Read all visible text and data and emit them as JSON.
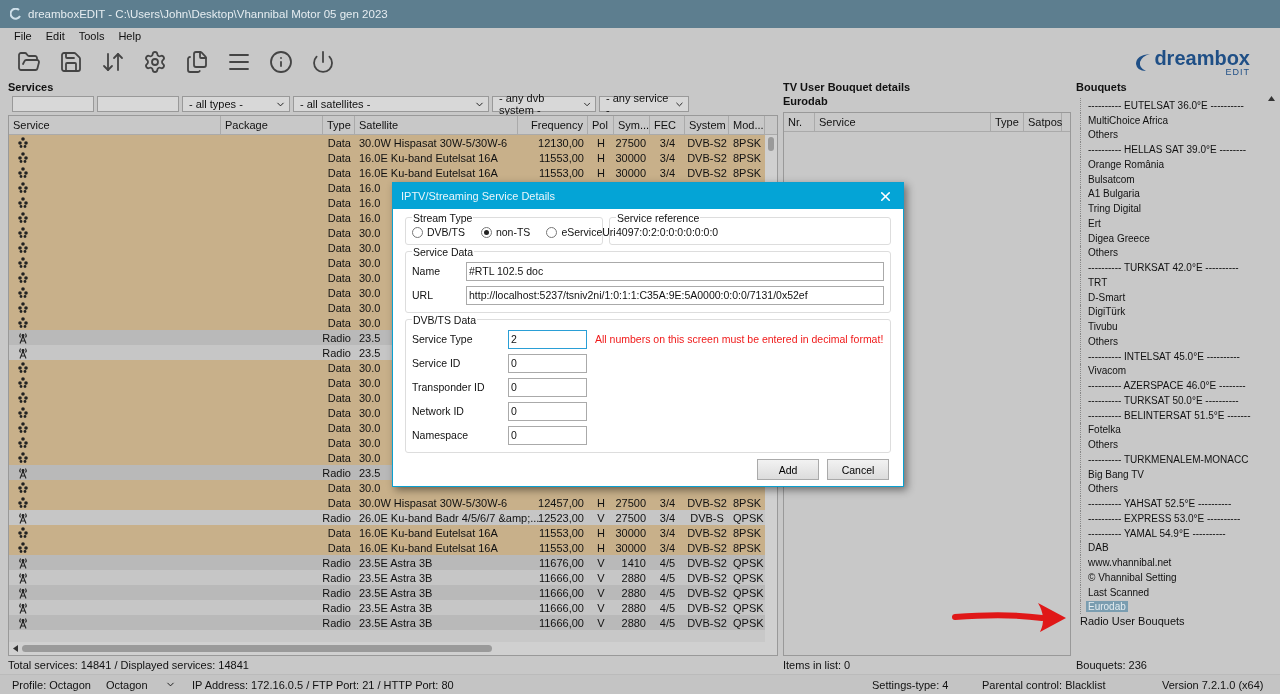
{
  "window": {
    "title": "dreamboxEDIT - C:\\Users\\John\\Desktop\\Vhannibal Motor 05 gen 2023"
  },
  "menu": [
    "File",
    "Edit",
    "Tools",
    "Help"
  ],
  "toolbar": [
    {
      "kind": "open"
    },
    {
      "kind": "save"
    },
    {
      "kind": "transfer"
    },
    {
      "kind": "settings"
    },
    {
      "kind": "copy"
    },
    {
      "kind": "list"
    },
    {
      "kind": "info"
    },
    {
      "kind": "power"
    }
  ],
  "logo": {
    "name": "dreambox",
    "sub": "EDIT"
  },
  "services": {
    "title": "Services",
    "filters": [
      {
        "kind": "text"
      },
      {
        "kind": "text"
      },
      {
        "kind": "select",
        "value": "- all types -"
      },
      {
        "kind": "select",
        "value": "- all satellites -"
      },
      {
        "kind": "select",
        "value": "- any dvb system -"
      },
      {
        "kind": "select",
        "value": "- any service -"
      }
    ],
    "columns": [
      "Service",
      "Package",
      "Type",
      "Satellite",
      "Frequency",
      "Pol",
      "Sym...",
      "FEC",
      "System",
      "Mod..."
    ],
    "rows": [
      {
        "kind": "data",
        "type": "Data",
        "satellite": "30.0W Hispasat 30W-5/30W-6",
        "frequency": "12130,00",
        "pol": "H",
        "sym": "27500",
        "fec": "3/4",
        "system": "DVB-S2",
        "mod": "8PSK"
      },
      {
        "kind": "data",
        "type": "Data",
        "satellite": "16.0E Ku-band Eutelsat 16A",
        "frequency": "11553,00",
        "pol": "H",
        "sym": "30000",
        "fec": "3/4",
        "system": "DVB-S2",
        "mod": "8PSK"
      },
      {
        "kind": "data",
        "type": "Data",
        "satellite": "16.0E Ku-band Eutelsat 16A",
        "frequency": "11553,00",
        "pol": "H",
        "sym": "30000",
        "fec": "3/4",
        "system": "DVB-S2",
        "mod": "8PSK"
      },
      {
        "kind": "data",
        "type": "Data",
        "satellite": "16.0"
      },
      {
        "kind": "data",
        "type": "Data",
        "satellite": "16.0"
      },
      {
        "kind": "data",
        "type": "Data",
        "satellite": "16.0"
      },
      {
        "kind": "data",
        "type": "Data",
        "satellite": "30.0"
      },
      {
        "kind": "data",
        "type": "Data",
        "satellite": "30.0"
      },
      {
        "kind": "data",
        "type": "Data",
        "satellite": "30.0"
      },
      {
        "kind": "data",
        "type": "Data",
        "satellite": "30.0"
      },
      {
        "kind": "data",
        "type": "Data",
        "satellite": "30.0"
      },
      {
        "kind": "data",
        "type": "Data",
        "satellite": "30.0"
      },
      {
        "kind": "data",
        "type": "Data",
        "satellite": "30.0"
      },
      {
        "kind": "radio",
        "type": "Radio",
        "satellite": "23.5"
      },
      {
        "kind": "radio",
        "type": "Radio",
        "satellite": "23.5"
      },
      {
        "kind": "data",
        "type": "Data",
        "satellite": "30.0"
      },
      {
        "kind": "data",
        "type": "Data",
        "satellite": "30.0"
      },
      {
        "kind": "data",
        "type": "Data",
        "satellite": "30.0"
      },
      {
        "kind": "data",
        "type": "Data",
        "satellite": "30.0"
      },
      {
        "kind": "data",
        "type": "Data",
        "satellite": "30.0"
      },
      {
        "kind": "data",
        "type": "Data",
        "satellite": "30.0"
      },
      {
        "kind": "data",
        "type": "Data",
        "satellite": "30.0"
      },
      {
        "kind": "radio",
        "type": "Radio",
        "satellite": "23.5"
      },
      {
        "kind": "data",
        "type": "Data",
        "satellite": "30.0"
      },
      {
        "kind": "data",
        "type": "Data",
        "satellite": "30.0W Hispasat 30W-5/30W-6",
        "frequency": "12457,00",
        "pol": "H",
        "sym": "27500",
        "fec": "3/4",
        "system": "DVB-S2",
        "mod": "8PSK"
      },
      {
        "kind": "radio",
        "type": "Radio",
        "satellite": "26.0E Ku-band Badr 4/5/6/7 &amp;...",
        "frequency": "12523,00",
        "pol": "V",
        "sym": "27500",
        "fec": "3/4",
        "system": "DVB-S",
        "mod": "QPSK"
      },
      {
        "kind": "data",
        "type": "Data",
        "satellite": "16.0E Ku-band Eutelsat 16A",
        "frequency": "11553,00",
        "pol": "H",
        "sym": "30000",
        "fec": "3/4",
        "system": "DVB-S2",
        "mod": "8PSK"
      },
      {
        "kind": "data",
        "type": "Data",
        "satellite": "16.0E Ku-band Eutelsat 16A",
        "frequency": "11553,00",
        "pol": "H",
        "sym": "30000",
        "fec": "3/4",
        "system": "DVB-S2",
        "mod": "8PSK"
      },
      {
        "kind": "radio",
        "type": "Radio",
        "satellite": "23.5E Astra 3B",
        "frequency": "11676,00",
        "pol": "V",
        "sym": "1410",
        "fec": "4/5",
        "system": "DVB-S2",
        "mod": "QPSK"
      },
      {
        "kind": "radio",
        "type": "Radio",
        "satellite": "23.5E Astra 3B",
        "frequency": "11666,00",
        "pol": "V",
        "sym": "2880",
        "fec": "4/5",
        "system": "DVB-S2",
        "mod": "QPSK"
      },
      {
        "kind": "radio",
        "type": "Radio",
        "satellite": "23.5E Astra 3B",
        "frequency": "11666,00",
        "pol": "V",
        "sym": "2880",
        "fec": "4/5",
        "system": "DVB-S2",
        "mod": "QPSK"
      },
      {
        "kind": "radio",
        "type": "Radio",
        "satellite": "23.5E Astra 3B",
        "frequency": "11666,00",
        "pol": "V",
        "sym": "2880",
        "fec": "4/5",
        "system": "DVB-S2",
        "mod": "QPSK"
      },
      {
        "kind": "radio",
        "type": "Radio",
        "satellite": "23.5E Astra 3B",
        "frequency": "11666,00",
        "pol": "V",
        "sym": "2880",
        "fec": "4/5",
        "system": "DVB-S2",
        "mod": "QPSK"
      }
    ],
    "footer": "Total services: 14841  /  Displayed services: 14841"
  },
  "bouquet_details": {
    "title": "TV User Bouquet details",
    "name": "Eurodab",
    "columns": [
      "Nr.",
      "Service",
      "Type",
      "Satpos"
    ],
    "footer": "Items in list: 0"
  },
  "bouquets": {
    "title": "Bouquets",
    "items": [
      {
        "label": "---------- EUTELSAT 36.0°E ----------",
        "selected": false
      },
      {
        "label": "MultiChoice Africa",
        "selected": false
      },
      {
        "label": "Others",
        "selected": false
      },
      {
        "label": "---------- HELLAS SAT 39.0°E --------",
        "selected": false
      },
      {
        "label": "Orange România",
        "selected": false
      },
      {
        "label": "Bulsatcom",
        "selected": false
      },
      {
        "label": "A1 Bulgaria",
        "selected": false
      },
      {
        "label": "Tring Digital",
        "selected": false
      },
      {
        "label": "Ert",
        "selected": false
      },
      {
        "label": "Digea Greece",
        "selected": false
      },
      {
        "label": "Others",
        "selected": false
      },
      {
        "label": "---------- TURKSAT 42.0°E ----------",
        "selected": false
      },
      {
        "label": "TRT",
        "selected": false
      },
      {
        "label": "D-Smart",
        "selected": false
      },
      {
        "label": "DigiTürk",
        "selected": false
      },
      {
        "label": "Tivubu",
        "selected": false
      },
      {
        "label": "Others",
        "selected": false
      },
      {
        "label": "---------- INTELSAT 45.0°E ----------",
        "selected": false
      },
      {
        "label": "Vivacom",
        "selected": false
      },
      {
        "label": "---------- AZERSPACE 46.0°E --------",
        "selected": false
      },
      {
        "label": "---------- TURKSAT 50.0°E ----------",
        "selected": false
      },
      {
        "label": "---------- BELINTERSAT 51.5°E -------",
        "selected": false
      },
      {
        "label": "Fotelka",
        "selected": false
      },
      {
        "label": "Others",
        "selected": false
      },
      {
        "label": "---------- TURKMENALEM-MONACC",
        "selected": false
      },
      {
        "label": "Big Bang TV",
        "selected": false
      },
      {
        "label": "Others",
        "selected": false
      },
      {
        "label": "---------- YAHSAT 52.5°E ----------",
        "selected": false
      },
      {
        "label": "---------- EXPRESS 53.0°E ----------",
        "selected": false
      },
      {
        "label": "---------- YAMAL 54.9°E ----------",
        "selected": false
      },
      {
        "label": "DAB",
        "selected": false
      },
      {
        "label": "www.vhannibal.net",
        "selected": false
      },
      {
        "label": "© Vhannibal Setting",
        "selected": false
      },
      {
        "label": "Last Scanned",
        "selected": false
      },
      {
        "label": "Eurodab",
        "selected": true
      }
    ],
    "root_items": [
      "Radio User Bouquets"
    ],
    "footer": "Bouquets: 236"
  },
  "status_bar": {
    "profile": "Profile: Octagon",
    "profile_select": "Octagon",
    "address": "IP Address: 172.16.0.5 / FTP Port: 21 / HTTP Port: 80",
    "settings_type": "Settings-type: 4",
    "parental": "Parental control: Blacklist",
    "version": "Version 7.2.1.0 (x64)"
  },
  "dialog": {
    "title": "IPTV/Streaming Service Details",
    "stream_type": {
      "title": "Stream Type",
      "options": [
        {
          "label": "DVB/TS",
          "selected": false
        },
        {
          "label": "non-TS",
          "selected": true
        },
        {
          "label": "eServiceUri",
          "selected": false
        }
      ]
    },
    "service_reference": {
      "title": "Service reference",
      "value": "4097:0:2:0:0:0:0:0:0:0"
    },
    "service_data": {
      "title": "Service Data",
      "fields": [
        {
          "label": "Name",
          "value": "#RTL 102.5 doc"
        },
        {
          "label": "URL",
          "value": "http://localhost:5237/tsniv2ni/1:0:1:1:C35A:9E:5A0000:0:0:0/7131/0x52ef"
        }
      ]
    },
    "dvb_data": {
      "title": "DVB/TS Data",
      "fields": [
        {
          "label": "Service Type",
          "value": "2",
          "focused": true
        },
        {
          "label": "Service ID",
          "value": "0",
          "focused": false
        },
        {
          "label": "Transponder ID",
          "value": "0",
          "focused": false
        },
        {
          "label": "Network ID",
          "value": "0",
          "focused": false
        },
        {
          "label": "Namespace",
          "value": "0",
          "focused": false
        }
      ],
      "warning": "All numbers on this screen must be entered in decimal format!"
    },
    "buttons": [
      "Add",
      "Cancel"
    ]
  }
}
